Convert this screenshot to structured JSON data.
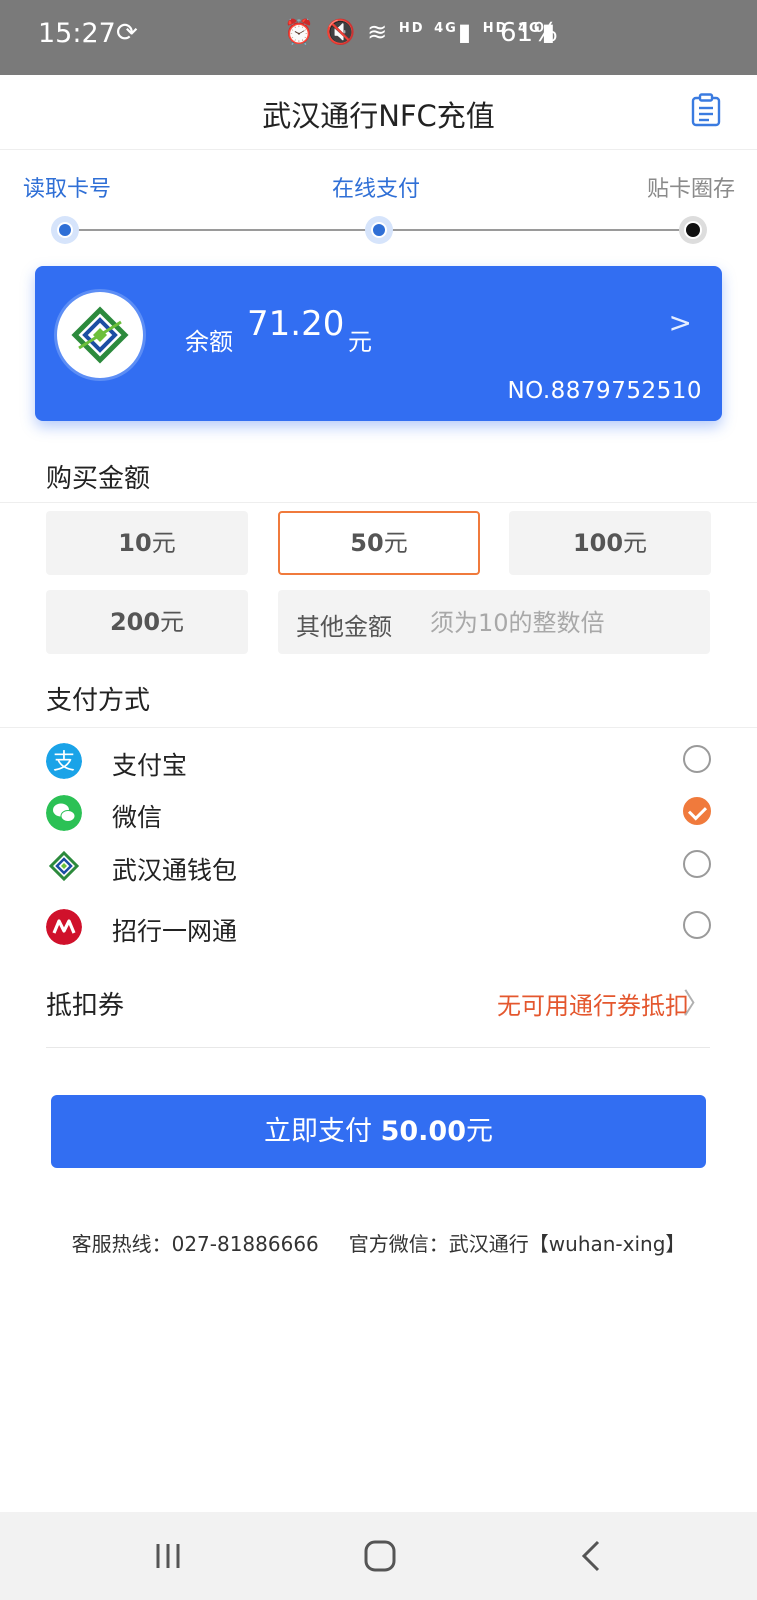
{
  "status_bar": {
    "time": "15:27",
    "sync_icon": "sync-icon",
    "hd1": "HD",
    "net1": "4G",
    "hd2": "HD",
    "net2": "4G",
    "battery": "61%"
  },
  "header": {
    "title": "武汉通行NFC充值",
    "action_icon": "clipboard-icon"
  },
  "steps": [
    {
      "label": "读取卡号",
      "state": "active"
    },
    {
      "label": "在线支付",
      "state": "active"
    },
    {
      "label": "贴卡圈存",
      "state": "pending"
    }
  ],
  "card": {
    "balance_label": "余额",
    "balance_value": "71.20",
    "balance_unit": "元",
    "card_number": "NO.8879752510"
  },
  "purchase": {
    "title": "购买金额",
    "unit": "元",
    "options": [
      {
        "value": "10",
        "selected": false
      },
      {
        "value": "50",
        "selected": true
      },
      {
        "value": "100",
        "selected": false
      },
      {
        "value": "200",
        "selected": false
      }
    ],
    "other_label": "其他金额",
    "other_placeholder": "须为10的整数倍"
  },
  "payment": {
    "title": "支付方式",
    "methods": [
      {
        "label": "支付宝",
        "icon": "alipay-icon",
        "checked": false
      },
      {
        "label": "微信",
        "icon": "wechat-icon",
        "checked": true
      },
      {
        "label": "武汉通钱包",
        "icon": "wuhantong-wallet-icon",
        "checked": false
      },
      {
        "label": "招行一网通",
        "icon": "cmb-icon",
        "checked": false
      }
    ]
  },
  "coupon": {
    "label": "抵扣券",
    "value": "无可用通行券抵扣"
  },
  "pay_button": {
    "prefix": "立即支付",
    "amount": "50.00",
    "unit": "元"
  },
  "footer": {
    "hotline": "客服热线：027-81886666",
    "wechat": "官方微信：武汉通行【wuhan-xing】"
  },
  "colors": {
    "primary": "#326ef2",
    "accent": "#f07a3c",
    "coupon_text": "#e4572e"
  }
}
